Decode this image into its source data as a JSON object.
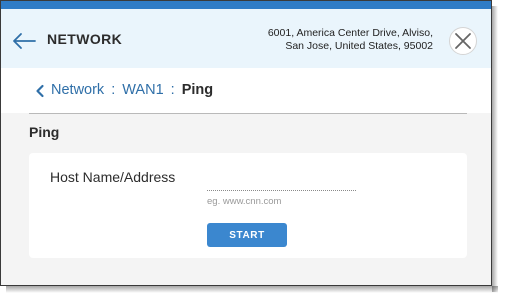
{
  "header": {
    "title": "NETWORK",
    "address_line1": "6001, America Center Drive, Alviso,",
    "address_line2": "San Jose, United States, 95002",
    "icons": {
      "back": "arrow-left-icon",
      "close": "close-icon"
    }
  },
  "breadcrumb": {
    "items": [
      {
        "label": "Network"
      },
      {
        "label": "WAN1"
      }
    ],
    "separator": ":",
    "current": "Ping",
    "icon": "chevron-left-icon"
  },
  "section": {
    "title": "Ping"
  },
  "form": {
    "host_label": "Host Name/Address",
    "host_value": "",
    "host_placeholder": "",
    "host_hint": "eg. www.cnn.com",
    "start_label": "START"
  },
  "colors": {
    "accent": "#2f7cc6",
    "header_bg": "#eaf5fc",
    "link": "#2f6fa8",
    "button": "#3b87cf"
  }
}
